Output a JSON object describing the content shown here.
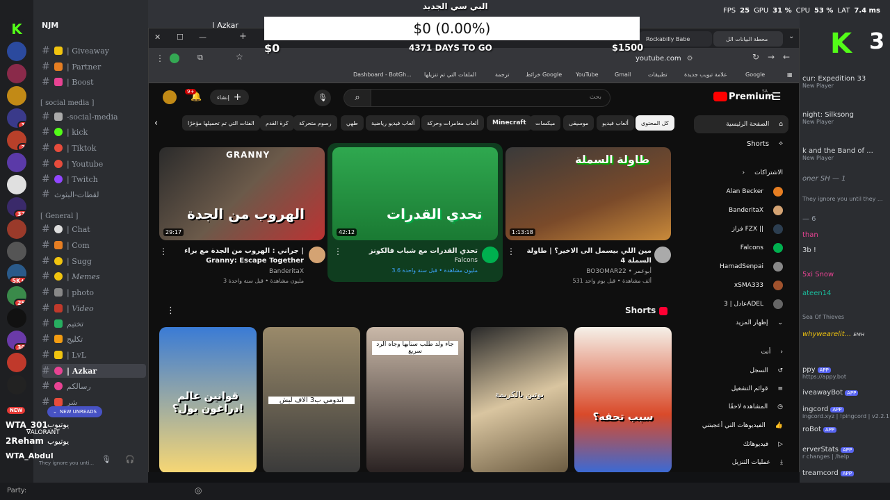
{
  "overlay": {
    "top_title": "البي سي الجديد",
    "donation_text": "$0 (0.00%)",
    "goal_start": "$0",
    "days_to_go": "4371 DAYS TO GO",
    "goal_end": "$1500",
    "fps_label": "FPS",
    "fps_value": "25",
    "gpu_label": "GPU",
    "gpu_value": "31 %",
    "cpu_label": "CPU",
    "cpu_value": "53 %",
    "lat_label": "LAT",
    "lat_value": "7.4 ms",
    "logo_letter": "K",
    "logo_number": "3"
  },
  "discord": {
    "server_name": "NJM",
    "channels": [
      {
        "label": "| Giveaway"
      },
      {
        "label": "| Partner"
      },
      {
        "label": "| Boost"
      },
      {
        "label": "[ social media ]"
      },
      {
        "label": "-social-media"
      },
      {
        "label": "| kick"
      },
      {
        "label": "| Tiktok"
      },
      {
        "label": "| Youtube"
      },
      {
        "label": "| Twitch"
      },
      {
        "label": "لقطات-البثوث"
      },
      {
        "label": "[ General ]"
      },
      {
        "label": "| Chat"
      },
      {
        "label": "| Com"
      },
      {
        "label": "| Sugg"
      },
      {
        "label": "| Memes"
      },
      {
        "label": "| photo"
      },
      {
        "label": "| Video"
      },
      {
        "label": "تختيم"
      },
      {
        "label": "تكليج"
      },
      {
        "label": "| LvL"
      },
      {
        "label": "| Azkar"
      },
      {
        "label": "رسالكم"
      },
      {
        "label": "شر"
      }
    ],
    "new_unreads": "NEW UNREADS",
    "new_badge": "NEW",
    "user1": "WTA_301",
    "user1_sub": "يوتيوب",
    "user1_game": "VALORANT",
    "user2": "2Reham",
    "user2_sub": "يوتيوب",
    "self_name": "WTA_Abdul",
    "self_status": "They ignore you unti...",
    "server_badges": [
      "",
      "",
      "",
      "",
      "1",
      "2",
      "",
      "",
      "32",
      "",
      "",
      "5K+",
      "25",
      "",
      "",
      "30",
      "",
      "",
      ""
    ],
    "header_channel": "| Azkar",
    "party_label": "Party:"
  },
  "members": [
    {
      "name": "cur: Expedition 33",
      "sub": "New Player"
    },
    {
      "name": "night: Silksong",
      "sub": "New Player"
    },
    {
      "name": "k and the Band of ...",
      "sub": "New Player"
    },
    {
      "name": "oner SH — 1",
      "sub": ""
    },
    {
      "name": "They ignore you until they ...",
      "sub": ""
    },
    {
      "name": "— 6",
      "sub": ""
    },
    {
      "name": "than",
      "sub": ""
    },
    {
      "name": "3b !",
      "sub": ""
    },
    {
      "name": "5xi  Snow",
      "sub": ""
    },
    {
      "name": "ateen14",
      "sub": ""
    },
    {
      "name": "Sea Of Thieves",
      "sub": ""
    },
    {
      "name": "whywearelit...",
      "sub": "EMH"
    },
    {
      "name": "ppy",
      "sub": "https://appy.bot",
      "app": "APP"
    },
    {
      "name": "iveawayBot",
      "sub": "",
      "app": "APP"
    },
    {
      "name": "ingcord",
      "sub": "ingcord.xyz | !pingcord | v2.2.1",
      "app": "APP"
    },
    {
      "name": "roBot",
      "sub": "",
      "app": "APP"
    },
    {
      "name": "erverStats",
      "sub": "r changes | /help",
      "app": "APP"
    },
    {
      "name": "treamcord",
      "sub": "",
      "app": "APP"
    }
  ],
  "browser": {
    "tabs": [
      "Rockabilly Babe",
      "محطة البيانات الل"
    ],
    "url": "youtube.com",
    "bookmarks": [
      "Google",
      "علامة تبويب جديدة",
      "تطبيقات",
      "Gmail",
      "YouTube",
      "خرائط Google",
      "ترجمة",
      "الملفات التي تم تنزيلها",
      "Dashboard - BotGh..."
    ]
  },
  "youtube": {
    "brand": "Premium",
    "brand_region": "SA",
    "search_placeholder": "بحث",
    "create_label": "إنشاء",
    "notif_count": "9+",
    "chips": [
      "كل المحتوى",
      "ألعاب فيديو",
      "موسيقى",
      "ميكسات",
      "Minecraft",
      "ألعاب مغامرات وحركة",
      "ألعاب فيديو رياضية",
      "طهي",
      "رسوم متحركة",
      "كرة القدم",
      "الفئات التي تم تحميلها مؤخرًا"
    ],
    "sidebar": {
      "home": "الصفحة الرئيسية",
      "shorts": "Shorts",
      "subs_header": "الاشتراكات",
      "subs": [
        "Alan Becker",
        "BanderitaX",
        "فراز FZX ||",
        "Falcons",
        "HamadSenpai",
        "xSMA333",
        "عادل | 3ADEL"
      ],
      "show_more": "إظهار المزيد",
      "you_header": "أنت",
      "you_items": [
        "السجل",
        "قوائم التشغيل",
        "المشاهدة لاحقًا",
        "الفيديوهات التي أعجبتني",
        "فيديوهاتك",
        "عمليات التنزيل"
      ]
    },
    "videos": [
      {
        "title": "جراني : الهروب من الجدة مع براء | Granny: Escape Together",
        "channel": "BanderitaX",
        "meta": "3 مليون مشاهدة • قبل سنة واحدة",
        "duration": "29:17",
        "thumb_text": "الهروب من الجدة",
        "thumb_badge": "GRANNY"
      },
      {
        "title": "تحدي القدرات مع شباب فالكونز",
        "channel": "Falcons",
        "meta": "3.6 مليون مشاهدة • قبل سنة واحدة",
        "duration": "42:12",
        "thumb_text": "تحدي القدرات"
      },
      {
        "title": "مين اللي بيسمل الى الاخير؟ | طاولة السملة 4",
        "channel": "BO3OMAR22 • أبوعمر",
        "meta": "531 ألف مشاهدة • قبل يوم واحد",
        "duration": "1:13:18",
        "thumb_text": "طاولة السملة"
      }
    ],
    "shorts_title": "Shorts",
    "shorts": [
      {
        "text": "قوانين عالم دراغون بول؟!"
      },
      {
        "text": "اندومي ب3 الاف ليش"
      },
      {
        "text": "جاء ولد طلب سنابها وجاه الرد سريع"
      },
      {
        "text": "بوتين بالكريمة"
      },
      {
        "text": "سبب تحفه؟"
      }
    ]
  }
}
